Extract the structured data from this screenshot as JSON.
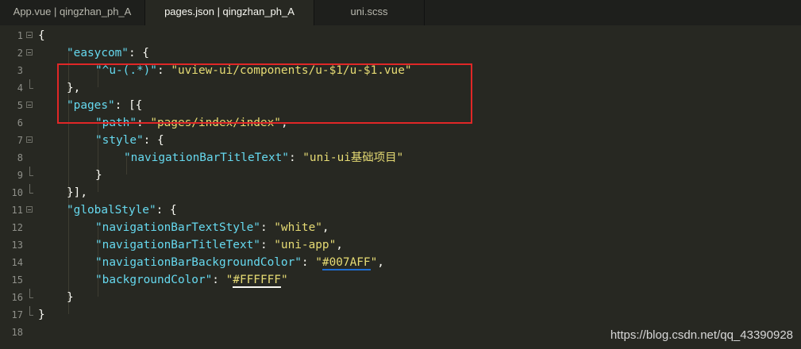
{
  "tabs": [
    {
      "label": "App.vue | qingzhan_ph_A",
      "active": false
    },
    {
      "label": "pages.json | qingzhan_ph_A",
      "active": true
    },
    {
      "label": "uni.scss",
      "active": false
    }
  ],
  "editor": {
    "line_numbers": [
      "1",
      "2",
      "3",
      "4",
      "5",
      "6",
      "7",
      "8",
      "9",
      "10",
      "11",
      "12",
      "13",
      "14",
      "15",
      "16",
      "17",
      "18"
    ],
    "code": {
      "l1": "{",
      "l2_key": "\"easycom\"",
      "l2_rest": ": {",
      "l3_key": "\"^u-(.*)\"",
      "l3_sep": ": ",
      "l3_val": "\"uview-ui/components/u-$1/u-$1.vue\"",
      "l4": "},",
      "l5_key": "\"pages\"",
      "l5_rest": ": [{",
      "l6_key": "\"path\"",
      "l6_sep": ": ",
      "l6_val": "\"pages/index/index\"",
      "l6_end": ",",
      "l7_key": "\"style\"",
      "l7_rest": ": {",
      "l8_key": "\"navigationBarTitleText\"",
      "l8_sep": ": ",
      "l8_val": "\"uni-ui基础项目\"",
      "l9": "}",
      "l10": "}],",
      "l11_key": "\"globalStyle\"",
      "l11_rest": ": {",
      "l12_key": "\"navigationBarTextStyle\"",
      "l12_sep": ": ",
      "l12_val": "\"white\"",
      "l12_end": ",",
      "l13_key": "\"navigationBarTitleText\"",
      "l13_sep": ": ",
      "l13_val": "\"uni-app\"",
      "l13_end": ",",
      "l14_key": "\"navigationBarBackgroundColor\"",
      "l14_sep": ": ",
      "l14_q1": "\"",
      "l14_color": "#007AFF",
      "l14_q2": "\"",
      "l14_end": ",",
      "l15_key": "\"backgroundColor\"",
      "l15_sep": ": ",
      "l15_q1": "\"",
      "l15_color": "#FFFFFF",
      "l15_q2": "\"",
      "l16": "}",
      "l17": "}"
    }
  },
  "watermark": "https://blog.csdn.net/qq_43390928",
  "colors": {
    "background": "#272822",
    "string": "#e6db74",
    "key": "#66d9ef",
    "highlight_box": "#e02727",
    "blue_underline": "#1e6ed2"
  }
}
